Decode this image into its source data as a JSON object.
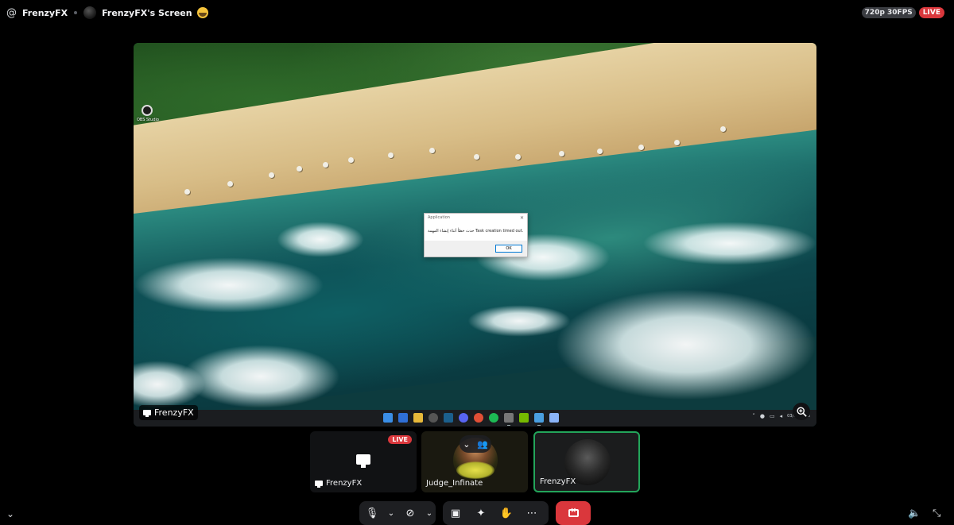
{
  "header": {
    "channel_name": "FrenzyFX",
    "stream_title": "FrenzyFX's Screen",
    "quality": "720p 30FPS",
    "live": "LIVE"
  },
  "stream": {
    "desktop_icon_label": "OBS Studio",
    "dialog": {
      "title": "Application",
      "message": "حدث خطأ أثناء إنشاء المهمة Task creation timed out.",
      "ok_label": "OK"
    },
    "label": "FrenzyFX",
    "clock": "03/02/2026"
  },
  "tiles": [
    {
      "name": "FrenzyFX",
      "badge": "LIVE"
    },
    {
      "name": "Judge_Infinate"
    },
    {
      "name": "FrenzyFX"
    }
  ],
  "colors": {
    "live_red": "#da373c",
    "speaking_green": "#23a55a",
    "control_bg": "#1e1f22"
  }
}
